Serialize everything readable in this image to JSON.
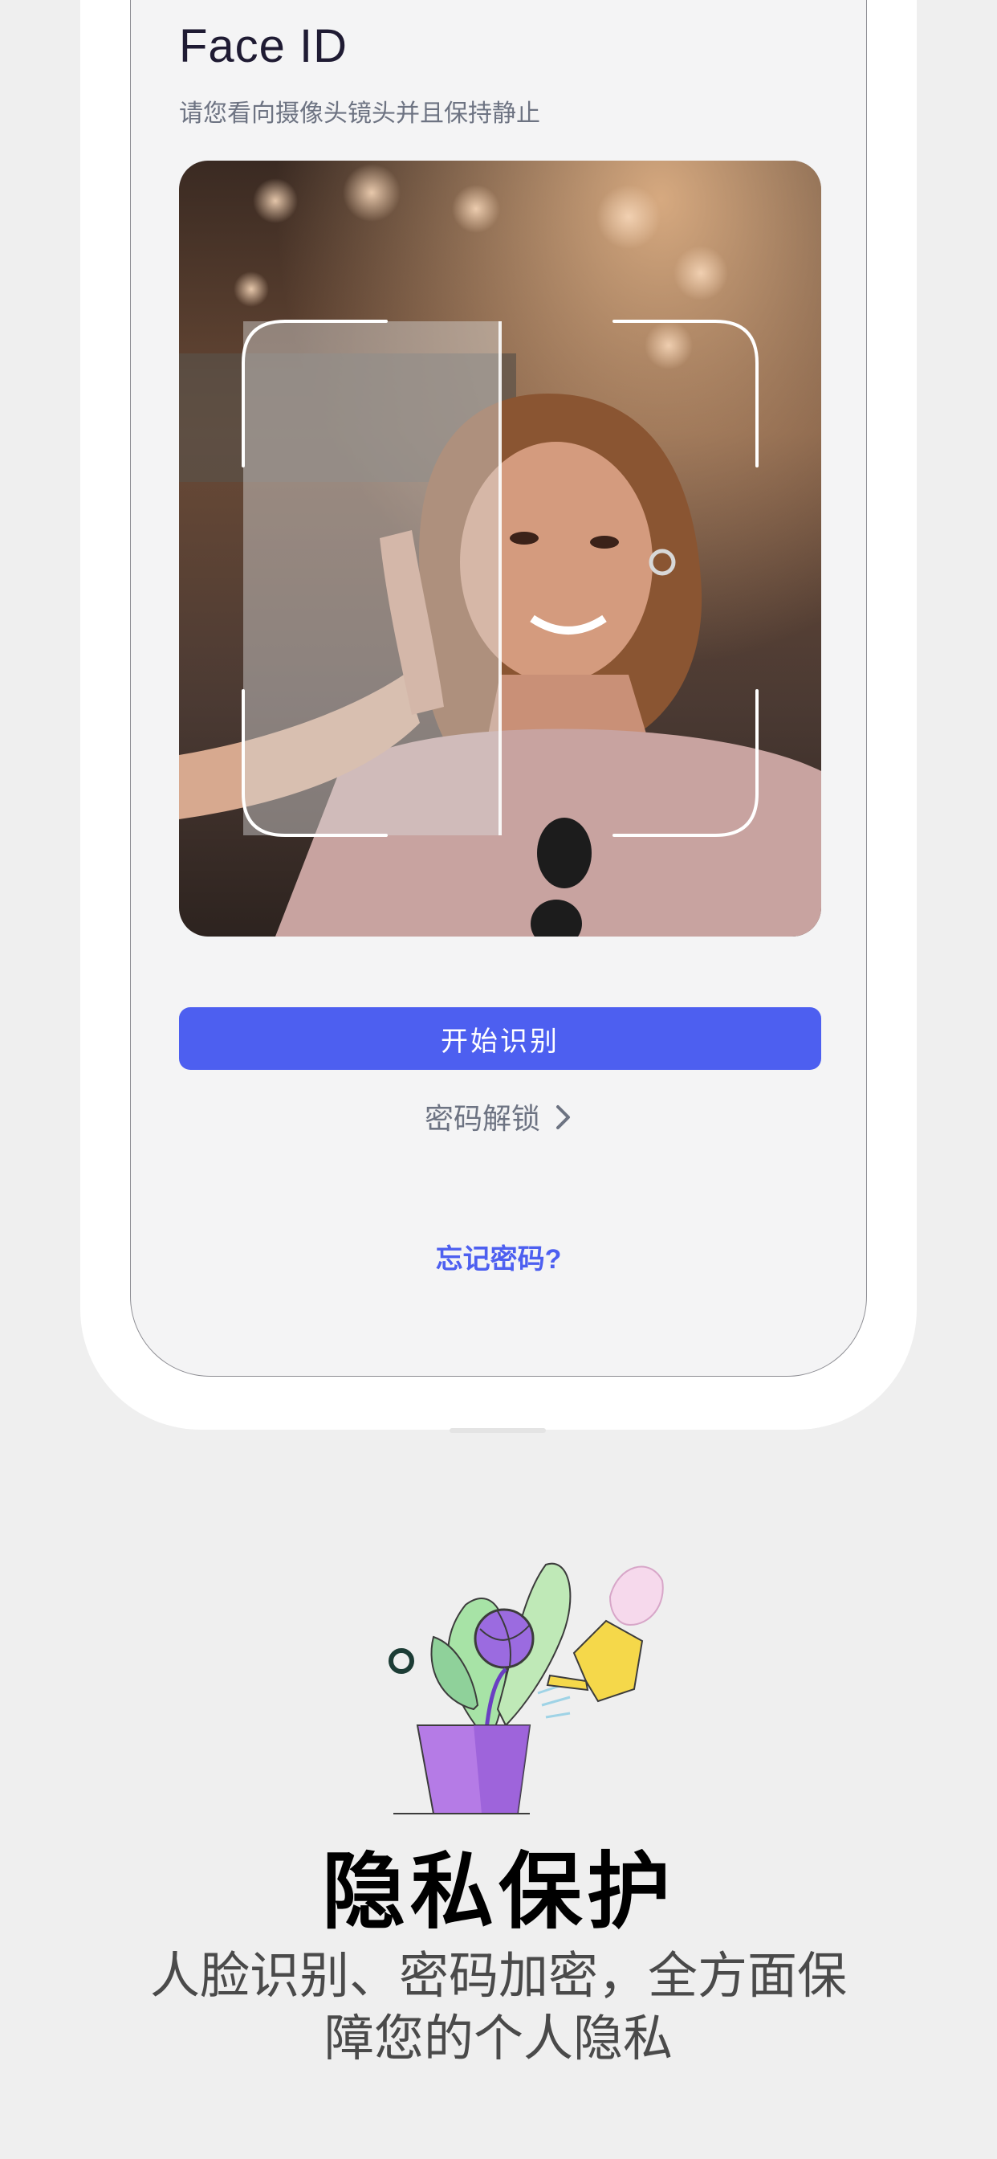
{
  "screen": {
    "title": "Face ID",
    "subtitle": "请您看向摄像头镜头并且保持静止",
    "primary_button": "开始识别",
    "password_unlock": "密码解锁",
    "forgot_password": "忘记密码?"
  },
  "feature": {
    "title": "隐私保护",
    "description": "人脸识别、密码加密，全方面保障您的个人隐私"
  },
  "colors": {
    "accent": "#4d5ff0",
    "background": "#efefef",
    "screen_bg": "#f4f4f5",
    "muted_text": "#6d7382"
  },
  "icons": {
    "unlock_chevron": "chevron-right-icon",
    "scan_frame": "face-scan-corners-icon"
  }
}
